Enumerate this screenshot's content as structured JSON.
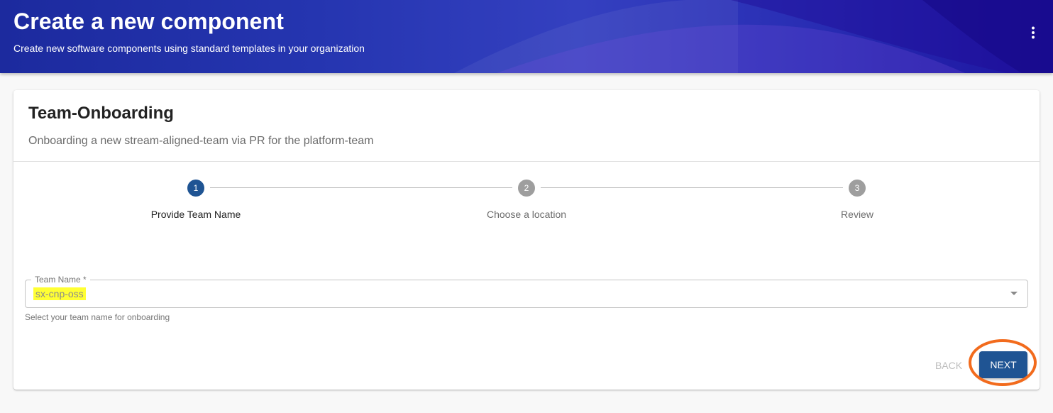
{
  "header": {
    "title": "Create a new component",
    "subtitle": "Create new software components using standard templates in your organization",
    "menu_icon": "kebab-vertical-icon"
  },
  "template": {
    "title": "Team-Onboarding",
    "description": "Onboarding a new stream-aligned-team via PR for the platform-team"
  },
  "stepper": {
    "active_step": 1,
    "steps": [
      {
        "number": "1",
        "label": "Provide Team Name",
        "status": "active"
      },
      {
        "number": "2",
        "label": "Choose a location",
        "status": "inactive"
      },
      {
        "number": "3",
        "label": "Review",
        "status": "inactive"
      }
    ]
  },
  "form": {
    "team_name": {
      "label": "Team Name *",
      "value": "sx-cnp-oss",
      "helper": "Select your team name for onboarding"
    }
  },
  "actions": {
    "back_label": "BACK",
    "next_label": "NEXT"
  },
  "colors": {
    "step_active": "#1f5493",
    "step_inactive": "#9e9e9e",
    "primary_button": "#1f5493",
    "highlight": "#ffff33",
    "annotation_ring": "#f26b1d"
  }
}
